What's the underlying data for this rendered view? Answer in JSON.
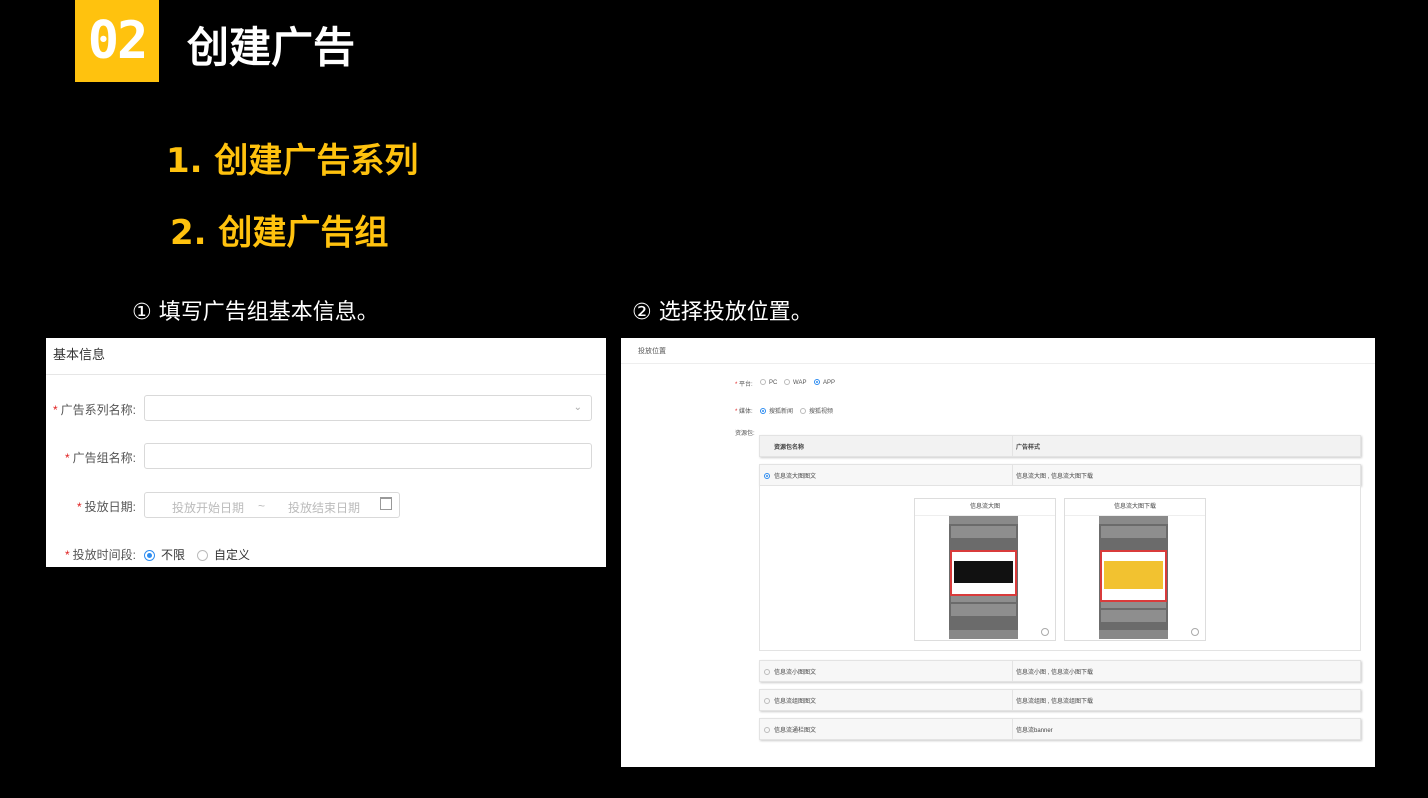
{
  "badge": "02",
  "title": "创建广告",
  "steps": [
    "1. 创建广告系列",
    "2. 创建广告组"
  ],
  "subs": [
    "① 填写广告组基本信息。",
    "② 选择投放位置。"
  ],
  "left_panel": {
    "header": "基本信息",
    "required_mark": "*",
    "fields": {
      "series_name_label": "广告系列名称:",
      "group_name_label": "广告组名称:",
      "date_label": "投放日期:",
      "date_start_placeholder": "投放开始日期",
      "date_separator": "~",
      "date_end_placeholder": "投放结束日期",
      "time_label": "投放时间段:",
      "time_options": [
        "不限",
        "自定义"
      ],
      "time_selected": "不限"
    }
  },
  "right_panel": {
    "header": "投放位置",
    "required_mark": "*",
    "platform_label": "平台:",
    "platform_options": [
      "PC",
      "WAP",
      "APP"
    ],
    "platform_selected": "APP",
    "media_label": "媒体:",
    "media_options": [
      "搜狐新闻",
      "搜狐视频"
    ],
    "media_selected": "搜狐新闻",
    "resource_label": "资源包:",
    "table_headers": [
      "资源包名称",
      "广告样式"
    ],
    "rows": [
      {
        "name": "信息流大图图文",
        "style": "信息流大图 , 信息流大图下载",
        "selected": true
      },
      {
        "name": "信息流小图图文",
        "style": "信息流小图 , 信息流小图下载",
        "selected": false
      },
      {
        "name": "信息流组图图文",
        "style": "信息流组图 , 信息流组图下载",
        "selected": false
      },
      {
        "name": "信息流通栏图文",
        "style": "信息流banner",
        "selected": false
      }
    ],
    "previews": [
      "信息流大图",
      "信息流大图下载"
    ]
  },
  "colors": {
    "accent": "#ffc20e",
    "radio_active": "#2d8cf0",
    "required": "#e02020",
    "ad_border": "#d93b3b"
  }
}
